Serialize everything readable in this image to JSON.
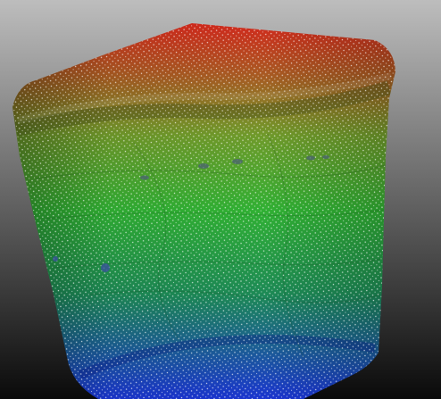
{
  "viewport": {
    "background_top": "#bdbdbd",
    "background_bottom": "#0a0a0a"
  },
  "point_cloud": {
    "object": "scanned-cylinder-mesh",
    "colormap": "height",
    "colormap_stops": [
      "#d2281c",
      "#a25a20",
      "#5fa62a",
      "#2fb035",
      "#1d8a55",
      "#1a35d0"
    ],
    "point_color": "#ffffff",
    "pore_color": "#4b6272"
  }
}
